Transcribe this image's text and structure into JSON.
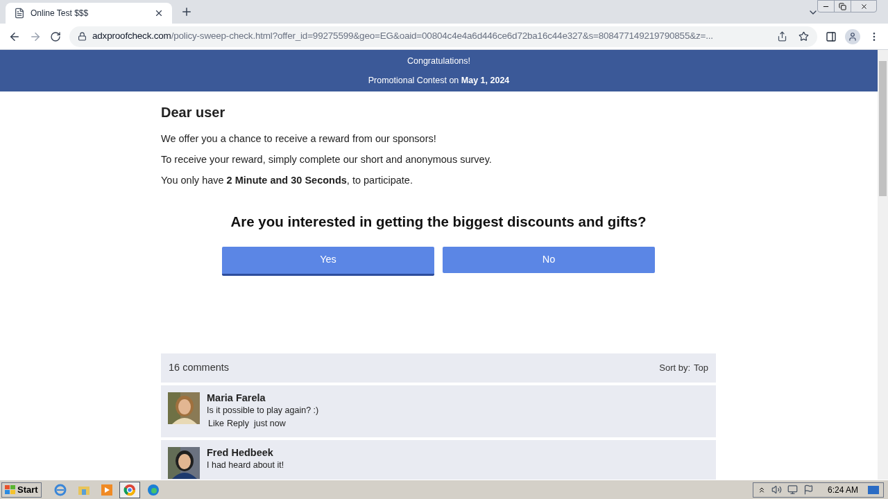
{
  "browser": {
    "tab": {
      "title": "Online Test $$$",
      "selected": true
    },
    "url": {
      "domain": "adxproofcheck.com",
      "path": "/policy-sweep-check.html?offer_id=99275599&geo=EG&oaid=00804c4e4a6d446ce6d72ba16c44e327&s=808477149219790855&z=..."
    }
  },
  "banner": {
    "title": "Congratulations!",
    "subtitle": "Promotional Contest on **May 1, 2024**"
  },
  "greeting": "Dear user",
  "paragraphs": [
    "We offer you a chance to receive a reward from our sponsors!",
    "To receive your reward, simply complete our short and anonymous survey.",
    "You only have **2 Minute and 30 Seconds**, to participate."
  ],
  "question": "Are you interested in getting the biggest discounts and gifts?",
  "answers": [
    {
      "label": "Yes",
      "selected": true
    },
    {
      "label": "No",
      "selected": false
    }
  ],
  "comments_header": {
    "count": "16 comments",
    "sort_label": "Sort by:",
    "sort_value": "Top"
  },
  "comments": [
    {
      "name": "Maria Farela",
      "text": "Is it possible to play again? :)",
      "like": "Like",
      "reply": "Reply",
      "time": "just now"
    },
    {
      "name": "Fred Hedbeek",
      "text": "I had heard about it!"
    }
  ],
  "taskbar": {
    "start": "Start",
    "clock": "6:24 AM"
  }
}
